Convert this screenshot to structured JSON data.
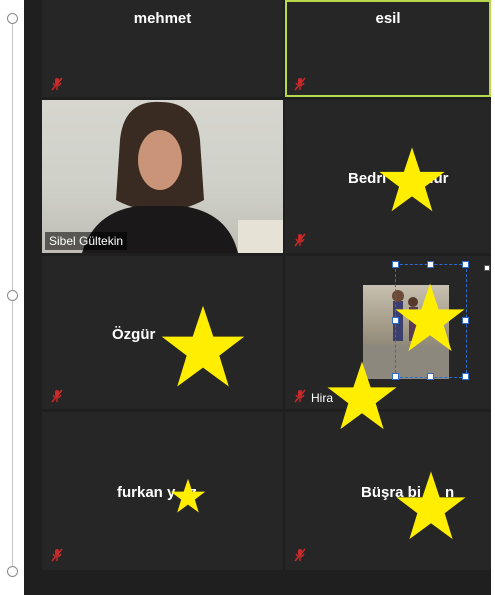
{
  "participants": [
    {
      "name": "mehmet",
      "muted": true,
      "video": false
    },
    {
      "name": "esil",
      "muted": true,
      "video": false,
      "active_speaker": true
    },
    {
      "name": "Sibel Gültekin",
      "muted": false,
      "video": true
    },
    {
      "name": "Bedri",
      "name_tail": "dur",
      "muted": true,
      "video": false
    },
    {
      "name": "Özgür",
      "muted": true,
      "video": false
    },
    {
      "name": "Hira",
      "muted": true,
      "video": true
    },
    {
      "name": "furkan y",
      "name_tail": "z",
      "muted": true,
      "video": false
    },
    {
      "name": "Büşra bi",
      "name_tail": "n",
      "muted": true,
      "video": false
    }
  ],
  "icons": {
    "mic_muted": "mic-muted-icon",
    "star_color": "#ffee00"
  },
  "colors": {
    "grid_bg": "#1f1f1f",
    "tile_bg": "#262626",
    "active_border": "#b7d84a",
    "selection": "#2e6bd0"
  }
}
